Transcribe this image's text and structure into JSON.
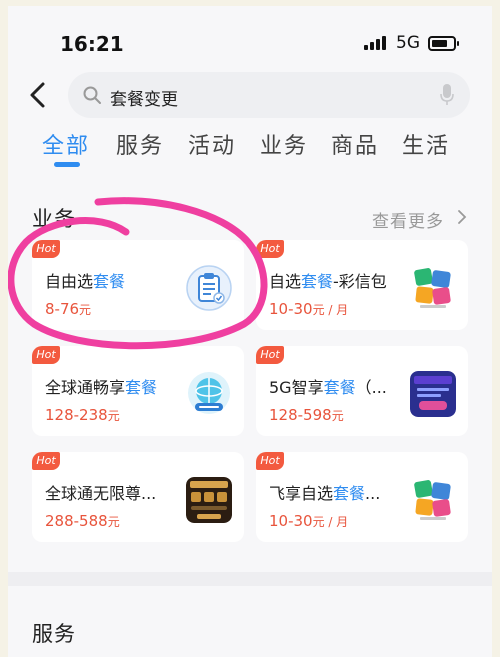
{
  "status": {
    "time": "16:21",
    "network": "5G"
  },
  "search": {
    "query": "套餐变更"
  },
  "tabs": [
    "全部",
    "服务",
    "活动",
    "业务",
    "商品",
    "生活"
  ],
  "section": {
    "title": "业务",
    "more": "查看更多"
  },
  "cards": [
    {
      "badge": "Hot",
      "name_plain": "自由选",
      "name_hl": "套餐",
      "name_tail": "",
      "price": "8-76",
      "unit": "元",
      "thumb": "clipboard-icon"
    },
    {
      "badge": "Hot",
      "name_plain": "自选",
      "name_hl": "套餐",
      "name_tail": "-彩信包",
      "price": "10-30",
      "unit": "元 / 月",
      "thumb": "zixuan-taocan-logo"
    },
    {
      "badge": "Hot",
      "name_plain": "全球通畅享",
      "name_hl": "套餐",
      "name_tail": "",
      "price": "128-238",
      "unit": "元",
      "thumb": "globe-share-logo"
    },
    {
      "badge": "Hot",
      "name_plain": "5G智享",
      "name_hl": "套餐",
      "name_tail": "（...",
      "price": "128-598",
      "unit": "元",
      "thumb": "5g-plan-logo"
    },
    {
      "badge": "Hot",
      "name_plain": "全球通无限尊...",
      "name_hl": "",
      "name_tail": "",
      "price": "288-588",
      "unit": "元",
      "thumb": "global-unlimited-logo"
    },
    {
      "badge": "Hot",
      "name_plain": "飞享自选",
      "name_hl": "套餐",
      "name_tail": "...",
      "price": "10-30",
      "unit": "元 / 月",
      "thumb": "zixuan-taocan-logo"
    }
  ],
  "section2": {
    "title": "服务"
  },
  "colors": {
    "accent": "#2f8cf0",
    "price": "#e8543c",
    "hot": "#f35a3f",
    "scribble": "#ef3fa0"
  }
}
